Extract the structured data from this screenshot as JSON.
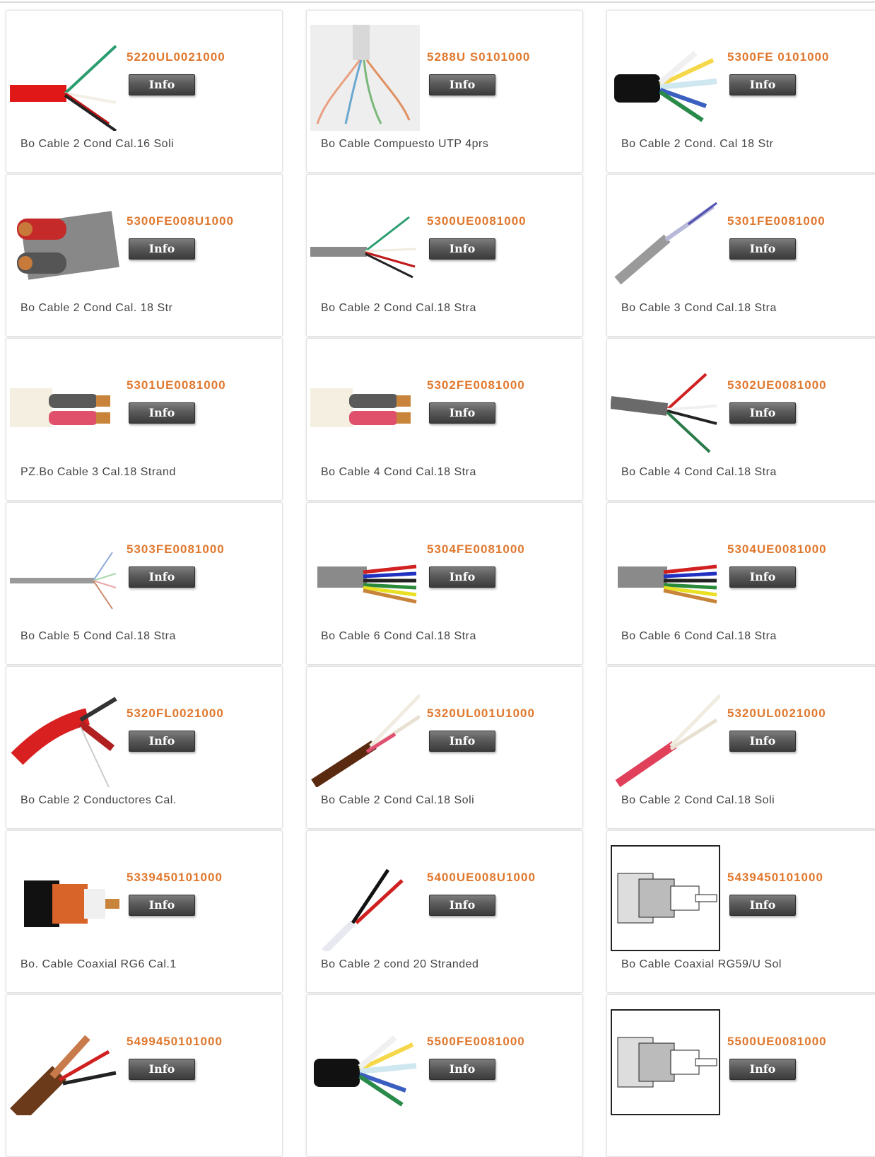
{
  "products": [
    {
      "code": "5220UL0021000",
      "info": "Info",
      "desc": "Bo Cable 2 Cond Cal.16 Soli",
      "icon": "red-cable-icon"
    },
    {
      "code": "5288U S0101000",
      "info": "Info",
      "desc": "Bo Cable Compuesto UTP 4prs",
      "icon": "utp-cable-icon"
    },
    {
      "code": "5300FE 0101000",
      "info": "Info",
      "desc": "Bo Cable 2 Cond. Cal 18 Str",
      "icon": "multicore-cable-icon"
    },
    {
      "code": "5300FE008U1000",
      "info": "Info",
      "desc": "Bo Cable 2 Cond Cal. 18 Str",
      "icon": "shielded-cable-icon"
    },
    {
      "code": "5300UE0081000",
      "info": "Info",
      "desc": "Bo Cable 2 Cond Cal.18 Stra",
      "icon": "gray-cable-icon"
    },
    {
      "code": "5301FE0081000",
      "info": "Info",
      "desc": "Bo Cable 3 Cond Cal.18 Stra",
      "icon": "gray-cable-icon"
    },
    {
      "code": "5301UE0081000",
      "info": "Info",
      "desc": "PZ.Bo Cable 3 Cal.18 Strand",
      "icon": "white-cable-icon"
    },
    {
      "code": "5302FE0081000",
      "info": "Info",
      "desc": "Bo Cable 4 Cond Cal.18 Stra",
      "icon": "white-cable-icon"
    },
    {
      "code": "5302UE0081000",
      "info": "Info",
      "desc": "Bo Cable 4 Cond Cal.18 Stra",
      "icon": "gray-multicore-cable-icon"
    },
    {
      "code": "5303FE0081000",
      "info": "Info",
      "desc": "Bo Cable 5 Cond Cal.18 Stra",
      "icon": "thin-gray-cable-icon"
    },
    {
      "code": "5304FE0081000",
      "info": "Info",
      "desc": "Bo Cable 6 Cond Cal.18 Stra",
      "icon": "colorful-cable-icon"
    },
    {
      "code": "5304UE0081000",
      "info": "Info",
      "desc": "Bo Cable 6 Cond Cal.18 Stra",
      "icon": "colorful-cable-icon"
    },
    {
      "code": "5320FL0021000",
      "info": "Info",
      "desc": "Bo Cable 2 Conductores Cal.",
      "icon": "red-shielded-cable-icon"
    },
    {
      "code": "5320UL001U1000",
      "info": "Info",
      "desc": "Bo Cable 2 Cond Cal.18 Soli",
      "icon": "brown-cable-icon"
    },
    {
      "code": "5320UL0021000",
      "info": "Info",
      "desc": "Bo Cable 2 Cond Cal.18 Soli",
      "icon": "red-cable-icon"
    },
    {
      "code": "5339450101000",
      "info": "Info",
      "desc": "Bo. Cable Coaxial RG6 Cal.1",
      "icon": "coaxial-cable-icon"
    },
    {
      "code": "5400UE008U1000",
      "info": "Info",
      "desc": "Bo Cable 2 cond 20 Stranded",
      "icon": "two-wire-cable-icon"
    },
    {
      "code": "5439450101000",
      "info": "Info",
      "desc": "Bo Cable Coaxial RG59/U Sol",
      "icon": "coaxial-drawing-icon"
    },
    {
      "code": "5499450101000",
      "info": "Info",
      "desc": "",
      "icon": "siamese-coaxial-icon"
    },
    {
      "code": "5500FE0081000",
      "info": "Info",
      "desc": "",
      "icon": "multicore-cable-icon"
    },
    {
      "code": "5500UE0081000",
      "info": "Info",
      "desc": "",
      "icon": "coaxial-drawing-icon"
    }
  ]
}
